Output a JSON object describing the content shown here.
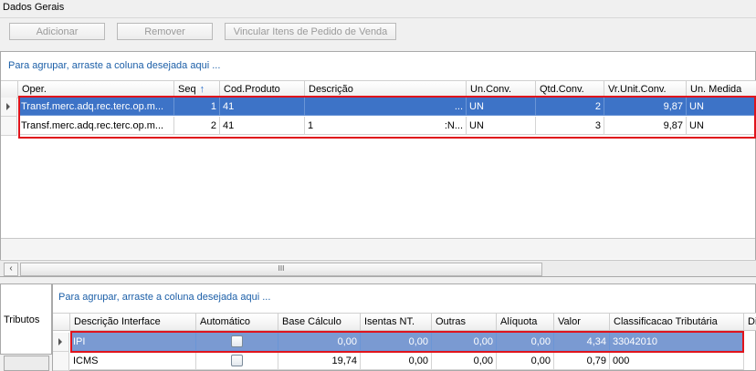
{
  "section_title": "Dados Gerais",
  "toolbar": {
    "add_label": "Adicionar",
    "remove_label": "Remover",
    "link_label": "Vincular Itens de Pedido de Venda"
  },
  "items_grid": {
    "group_hint": "Para agrupar, arraste a coluna desejada aqui ...",
    "columns": [
      "Oper.",
      "Seq",
      "Cod.Produto",
      "Descrição",
      "Un.Conv.",
      "Qtd.Conv.",
      "Vr.Unit.Conv.",
      "Un. Medida"
    ],
    "sort_icon": "sort-ascending-icon",
    "rows": [
      {
        "oper": "Transf.merc.adq.rec.terc.op.m...",
        "seq": "1",
        "cod": "41",
        "desc": "...",
        "unconv": "UN",
        "qtd": "2",
        "vr": "9,87",
        "un": "UN",
        "selected": true
      },
      {
        "oper": "Transf.merc.adq.rec.terc.op.m...",
        "seq": "2",
        "cod": "41",
        "desc": "1",
        "desc_right": ":N...",
        "unconv": "UN",
        "qtd": "3",
        "vr": "9,87",
        "un": "UN",
        "selected": false
      }
    ],
    "scroll_grip": "III"
  },
  "taxes_tab": {
    "label": "Tributos",
    "group_hint": "Para agrupar, arraste a coluna desejada aqui ...",
    "columns": [
      "Descrição Interface",
      "Automático",
      "Base Cálculo",
      "Isentas NT.",
      "Outras",
      "Alíquota",
      "Valor",
      "Classificacao Tributária",
      "Di"
    ],
    "rows": [
      {
        "desc": "IPI",
        "auto": false,
        "base": "0,00",
        "isentas": "0,00",
        "outras": "0,00",
        "aliquota": "0,00",
        "valor": "4,34",
        "classif": "33042010",
        "selected": true
      },
      {
        "desc": "ICMS",
        "auto": false,
        "base": "19,74",
        "isentas": "0,00",
        "outras": "0,00",
        "aliquota": "0,00",
        "valor": "0,79",
        "classif": "000",
        "selected": false
      }
    ]
  },
  "colors": {
    "selection": "#3d73c7",
    "highlight_box": "#e0141c",
    "hint_text": "#1c5fa8"
  }
}
